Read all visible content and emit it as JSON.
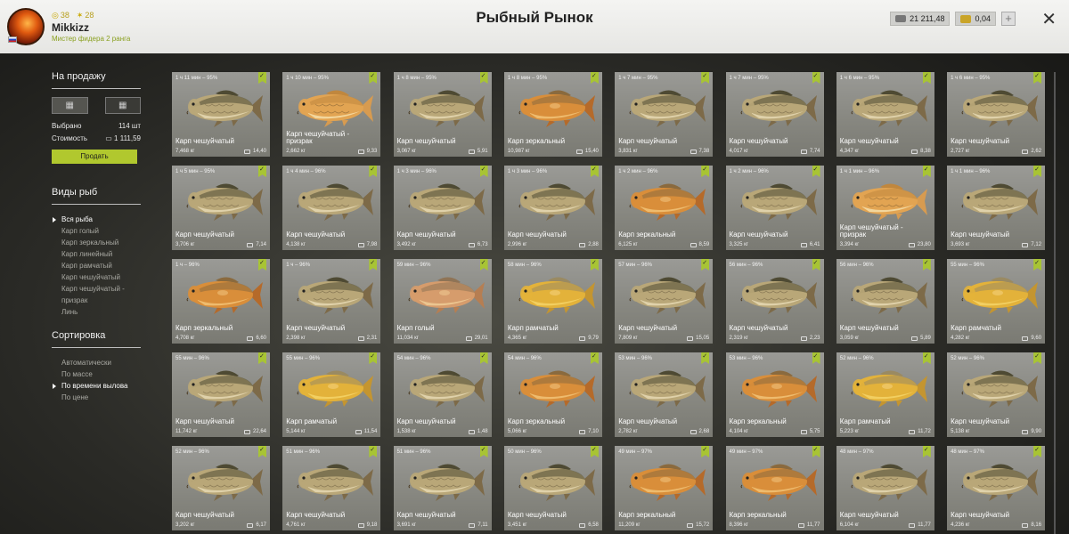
{
  "header": {
    "title": "Рыбный Рынок",
    "player": {
      "name": "Mikkizz",
      "rank": "Мистер фидера 2 ранга",
      "level": "38",
      "stars": "28"
    },
    "money": {
      "silver": "21 211,48",
      "gold": "0,04"
    },
    "plus_label": "+",
    "close_label": "✕"
  },
  "sidebar": {
    "sale_title": "На продажу",
    "selected_label": "Выбрано",
    "selected_value": "114 шт",
    "cost_label": "Стоимость",
    "cost_value": "1 111,59",
    "sell_label": "Продать",
    "species_title": "Виды рыб",
    "species": [
      "Вся рыба",
      "Карп голый",
      "Карп зеркальный",
      "Карп линейный",
      "Карп рамчатый",
      "Карп чешуйчатый",
      "Карп чешуйчатый - призрак",
      "Линь"
    ],
    "species_selected": 0,
    "sort_title": "Сортировка",
    "sort": [
      "Автоматически",
      "По массе",
      "По времени вылова",
      "По цене"
    ],
    "sort_selected": 2
  },
  "colors": {
    "accent": "#b1c82e",
    "card": "#8c8c86"
  },
  "fish": [
    {
      "time": "1 ч 11 мин – 95%",
      "name": "Карп чешуйчатый",
      "weight": "7,468 кг",
      "price": "14,40",
      "kind": "scaly"
    },
    {
      "time": "1 ч 10 мин – 95%",
      "name": "Карп чешуйчатый - призрак",
      "weight": "2,662 кг",
      "price": "9,33",
      "kind": "ghost"
    },
    {
      "time": "1 ч 8 мин – 95%",
      "name": "Карп чешуйчатый",
      "weight": "3,067 кг",
      "price": "5,91",
      "kind": "scaly"
    },
    {
      "time": "1 ч 8 мин – 95%",
      "name": "Карп зеркальный",
      "weight": "10,987 кг",
      "price": "15,40",
      "kind": "mirror"
    },
    {
      "time": "1 ч 7 мин – 95%",
      "name": "Карп чешуйчатый",
      "weight": "3,831 кг",
      "price": "7,38",
      "kind": "scaly"
    },
    {
      "time": "1 ч 7 мин – 95%",
      "name": "Карп чешуйчатый",
      "weight": "4,017 кг",
      "price": "7,74",
      "kind": "scaly"
    },
    {
      "time": "1 ч 6 мин – 95%",
      "name": "Карп чешуйчатый",
      "weight": "4,347 кг",
      "price": "8,38",
      "kind": "scaly"
    },
    {
      "time": "1 ч 6 мин – 95%",
      "name": "Карп чешуйчатый",
      "weight": "2,727 кг",
      "price": "2,62",
      "kind": "scaly"
    },
    {
      "time": "1 ч 5 мин – 95%",
      "name": "Карп чешуйчатый",
      "weight": "3,706 кг",
      "price": "7,14",
      "kind": "scaly"
    },
    {
      "time": "1 ч 4 мин – 96%",
      "name": "Карп чешуйчатый",
      "weight": "4,138 кг",
      "price": "7,98",
      "kind": "scaly"
    },
    {
      "time": "1 ч 3 мин – 96%",
      "name": "Карп чешуйчатый",
      "weight": "3,492 кг",
      "price": "6,73",
      "kind": "scaly"
    },
    {
      "time": "1 ч 3 мин – 96%",
      "name": "Карп чешуйчатый",
      "weight": "2,996 кг",
      "price": "2,88",
      "kind": "scaly"
    },
    {
      "time": "1 ч 2 мин – 96%",
      "name": "Карп зеркальный",
      "weight": "6,125 кг",
      "price": "8,59",
      "kind": "mirror"
    },
    {
      "time": "1 ч 2 мин – 96%",
      "name": "Карп чешуйчатый",
      "weight": "3,325 кг",
      "price": "6,41",
      "kind": "scaly"
    },
    {
      "time": "1 ч 1 мин – 96%",
      "name": "Карп чешуйчатый - призрак",
      "weight": "3,394 кг",
      "price": "23,80",
      "kind": "ghost"
    },
    {
      "time": "1 ч 1 мин – 96%",
      "name": "Карп чешуйчатый",
      "weight": "3,693 кг",
      "price": "7,12",
      "kind": "scaly"
    },
    {
      "time": "1 ч – 96%",
      "name": "Карп зеркальный",
      "weight": "4,708 кг",
      "price": "6,60",
      "kind": "mirror"
    },
    {
      "time": "1 ч – 96%",
      "name": "Карп чешуйчатый",
      "weight": "2,398 кг",
      "price": "2,31",
      "kind": "scaly"
    },
    {
      "time": "59 мин – 96%",
      "name": "Карп голый",
      "weight": "11,034 кг",
      "price": "29,01",
      "kind": "leather"
    },
    {
      "time": "58 мин – 96%",
      "name": "Карп рамчатый",
      "weight": "4,365 кг",
      "price": "9,79",
      "kind": "frame"
    },
    {
      "time": "57 мин – 96%",
      "name": "Карп чешуйчатый",
      "weight": "7,809 кг",
      "price": "15,05",
      "kind": "scaly"
    },
    {
      "time": "56 мин – 96%",
      "name": "Карп чешуйчатый",
      "weight": "2,319 кг",
      "price": "2,23",
      "kind": "scaly"
    },
    {
      "time": "56 мин – 96%",
      "name": "Карп чешуйчатый",
      "weight": "3,059 кг",
      "price": "5,89",
      "kind": "scaly"
    },
    {
      "time": "55 мин – 96%",
      "name": "Карп рамчатый",
      "weight": "4,282 кг",
      "price": "9,60",
      "kind": "frame"
    },
    {
      "time": "55 мин – 96%",
      "name": "Карп чешуйчатый",
      "weight": "11,742 кг",
      "price": "22,64",
      "kind": "scaly"
    },
    {
      "time": "55 мин – 96%",
      "name": "Карп рамчатый",
      "weight": "5,144 кг",
      "price": "11,54",
      "kind": "frame"
    },
    {
      "time": "54 мин – 96%",
      "name": "Карп чешуйчатый",
      "weight": "1,538 кг",
      "price": "1,48",
      "kind": "scaly"
    },
    {
      "time": "54 мин – 96%",
      "name": "Карп зеркальный",
      "weight": "5,066 кг",
      "price": "7,10",
      "kind": "mirror"
    },
    {
      "time": "53 мин – 96%",
      "name": "Карп чешуйчатый",
      "weight": "2,782 кг",
      "price": "2,68",
      "kind": "scaly"
    },
    {
      "time": "53 мин – 96%",
      "name": "Карп зеркальный",
      "weight": "4,104 кг",
      "price": "5,75",
      "kind": "mirror"
    },
    {
      "time": "52 мин – 96%",
      "name": "Карп рамчатый",
      "weight": "5,223 кг",
      "price": "11,72",
      "kind": "frame"
    },
    {
      "time": "52 мин – 96%",
      "name": "Карп чешуйчатый",
      "weight": "5,138 кг",
      "price": "9,90",
      "kind": "scaly"
    },
    {
      "time": "52 мин – 96%",
      "name": "Карп чешуйчатый",
      "weight": "3,202 кг",
      "price": "6,17",
      "kind": "scaly"
    },
    {
      "time": "51 мин – 96%",
      "name": "Карп чешуйчатый",
      "weight": "4,761 кг",
      "price": "9,18",
      "kind": "scaly"
    },
    {
      "time": "51 мин – 96%",
      "name": "Карп чешуйчатый",
      "weight": "3,691 кг",
      "price": "7,11",
      "kind": "scaly"
    },
    {
      "time": "50 мин – 96%",
      "name": "Карп чешуйчатый",
      "weight": "3,451 кг",
      "price": "6,58",
      "kind": "scaly"
    },
    {
      "time": "49 мин – 97%",
      "name": "Карп зеркальный",
      "weight": "11,209 кг",
      "price": "15,72",
      "kind": "mirror"
    },
    {
      "time": "49 мин – 97%",
      "name": "Карп зеркальный",
      "weight": "8,396 кг",
      "price": "11,77",
      "kind": "mirror"
    },
    {
      "time": "48 мин – 97%",
      "name": "Карп чешуйчатый",
      "weight": "6,104 кг",
      "price": "11,77",
      "kind": "scaly"
    },
    {
      "time": "48 мин – 97%",
      "name": "Карп чешуйчатый",
      "weight": "4,236 кг",
      "price": "8,16",
      "kind": "scaly"
    }
  ]
}
